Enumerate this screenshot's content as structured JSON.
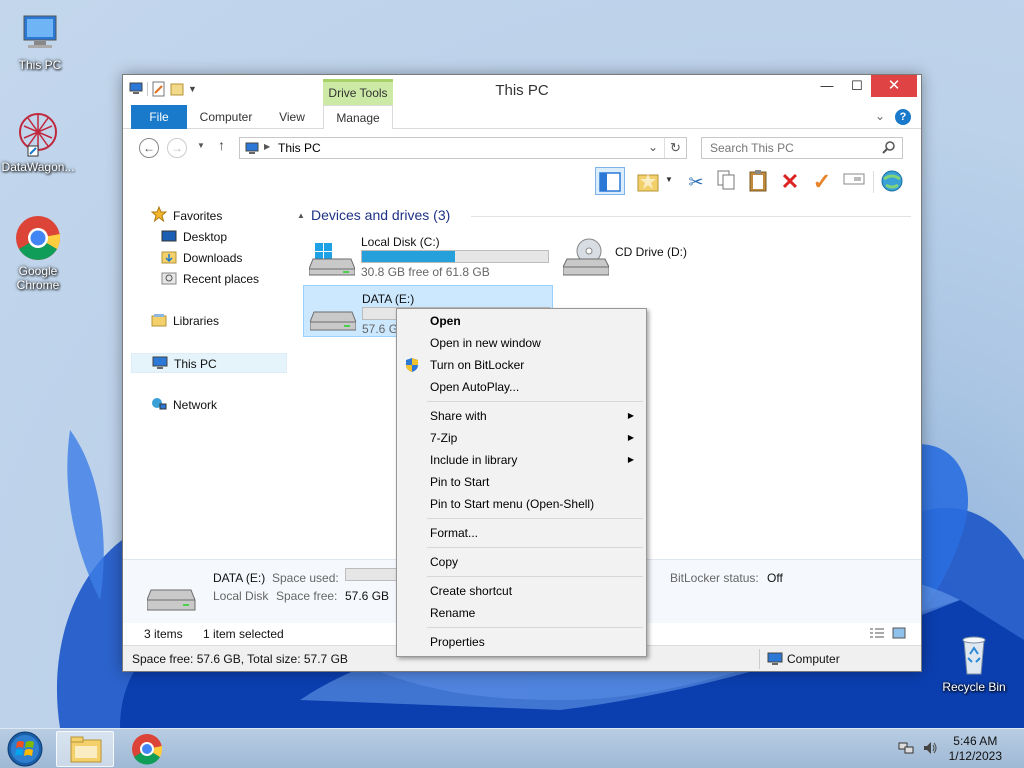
{
  "desktop": {
    "icons": [
      {
        "label": "This PC"
      },
      {
        "label": "DataWagon..."
      },
      {
        "label": "Google Chrome"
      },
      {
        "label": "Recycle Bin"
      }
    ]
  },
  "window": {
    "title": "This PC",
    "context_tab_group": "Drive Tools",
    "tabs": {
      "file": "File",
      "computer": "Computer",
      "view": "View",
      "manage": "Manage"
    },
    "controls": {
      "minimize": "—",
      "maximize": "☐",
      "close": "✕"
    }
  },
  "address": {
    "path": "This PC",
    "search_placeholder": "Search This PC"
  },
  "nav_pane": {
    "favorites": "Favorites",
    "desktop": "Desktop",
    "downloads": "Downloads",
    "recent": "Recent places",
    "libraries": "Libraries",
    "this_pc": "This PC",
    "network": "Network"
  },
  "content": {
    "group_title": "Devices and drives (3)",
    "drives": [
      {
        "name": "Local Disk (C:)",
        "free_text": "30.8 GB free of 61.8 GB",
        "used_fraction": 0.5
      },
      {
        "name": "CD Drive (D:)"
      },
      {
        "name": "DATA (E:)",
        "free_text": "57.6 GB",
        "used_fraction": 0.0
      }
    ]
  },
  "details_pane": {
    "name": "DATA (E:)",
    "type": "Local Disk",
    "space_used_label": "Space used:",
    "space_free_label": "Space free:",
    "space_free_value": "57.6 GB",
    "bitlocker_label": "BitLocker status:",
    "bitlocker_value": "Off"
  },
  "status": {
    "items": "3 items",
    "selected": "1 item selected",
    "bottom_left": "Space free: 57.6 GB, Total size: 57.7 GB",
    "bottom_right": "Computer"
  },
  "context_menu": {
    "open": "Open",
    "open_new_window": "Open in new window",
    "bitlocker": "Turn on BitLocker",
    "autoplay": "Open AutoPlay...",
    "share_with": "Share with",
    "seven_zip": "7-Zip",
    "include_library": "Include in library",
    "pin_start": "Pin to Start",
    "pin_start_menu": "Pin to Start menu (Open-Shell)",
    "format": "Format...",
    "copy": "Copy",
    "create_shortcut": "Create shortcut",
    "rename": "Rename",
    "properties": "Properties"
  },
  "taskbar": {
    "time": "5:46 AM",
    "date": "1/12/2023"
  },
  "colors": {
    "accent": "#1979ca",
    "drive_bar": "#26a0da",
    "selection": "#cce8ff",
    "close_button": "#e04343",
    "drive_tools": "#cde9a6"
  }
}
